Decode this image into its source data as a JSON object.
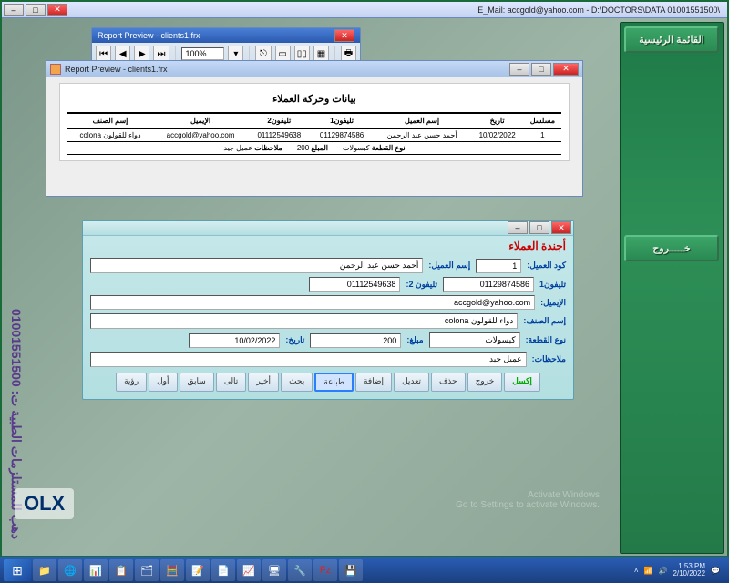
{
  "app": {
    "titlebar": "\\E_Mail: accgold@yahoo.com - D:\\DOCTORS\\DATA   01001551500"
  },
  "sidebar": {
    "btn_main": "القائمة الرئيسية",
    "btn_exit": "خـــــروج"
  },
  "vertical_banner": "دهب للمستلزمات الطبية ت: 01001551500",
  "olx": "OLX",
  "toolbar": {
    "title": "Report Preview - clients1.frx",
    "zoom": "100%"
  },
  "report": {
    "title": "Report Preview - clients1.frx",
    "heading": "بيانات وحركة العملاء",
    "cols": {
      "c1": "مسلسل",
      "c2": "تاريخ",
      "c3": "إسم العميل",
      "c4": "تليفون1",
      "c5": "تليفون2",
      "c6": "الإيميل",
      "c7": "إسم الصنف"
    },
    "row": {
      "serial": "1",
      "date": "10/02/2022",
      "name": "أحمد حسن عبد الرحمن",
      "phone1": "01129874586",
      "phone2": "01112549638",
      "email": "accgold@yahoo.com",
      "item": "دواء للقولون colona"
    },
    "sub": {
      "type_lbl": "نوع القطعة",
      "type_val": "كبسولات",
      "amount_lbl": "المبلغ",
      "amount_val": "200",
      "notes_lbl": "ملاحظات",
      "notes_val": "عميل جيد"
    }
  },
  "form": {
    "title": "أجندة العملاء",
    "lbl_code": "كود العميل:",
    "val_code": "1",
    "lbl_name": "إسم العميل:",
    "val_name": "أحمد حسن عبد الرحمن",
    "lbl_phone1": "تليفون1",
    "val_phone1": "01129874586",
    "lbl_phone2": "تليفون 2:",
    "val_phone2": "01112549638",
    "lbl_email": "الإيميل:",
    "val_email": "accgold@yahoo.com",
    "lbl_item": "إسم الصنف:",
    "val_item": "دواء للقولون colona",
    "lbl_type": "نوع القطعة:",
    "val_type": "كبسولات",
    "lbl_amount": "مبلغ:",
    "val_amount": "200",
    "lbl_date": "تاريخ:",
    "val_date": "10/02/2022",
    "lbl_notes": "ملاحظات:",
    "val_notes": "عميل جيد",
    "btns": {
      "excel": "إكسل",
      "exit": "خروج",
      "delete": "حذف",
      "edit": "تعديل",
      "add": "إضافة",
      "print": "طباعة",
      "search": "بحث",
      "last": "أخير",
      "next": "تالى",
      "prev": "سابق",
      "first": "أول",
      "view": "رؤية"
    }
  },
  "tray": {
    "time": "1:53 PM",
    "date": "2/10/2022"
  },
  "watermark": {
    "l1": "Activate Windows",
    "l2": "Go to Settings to activate Windows."
  }
}
